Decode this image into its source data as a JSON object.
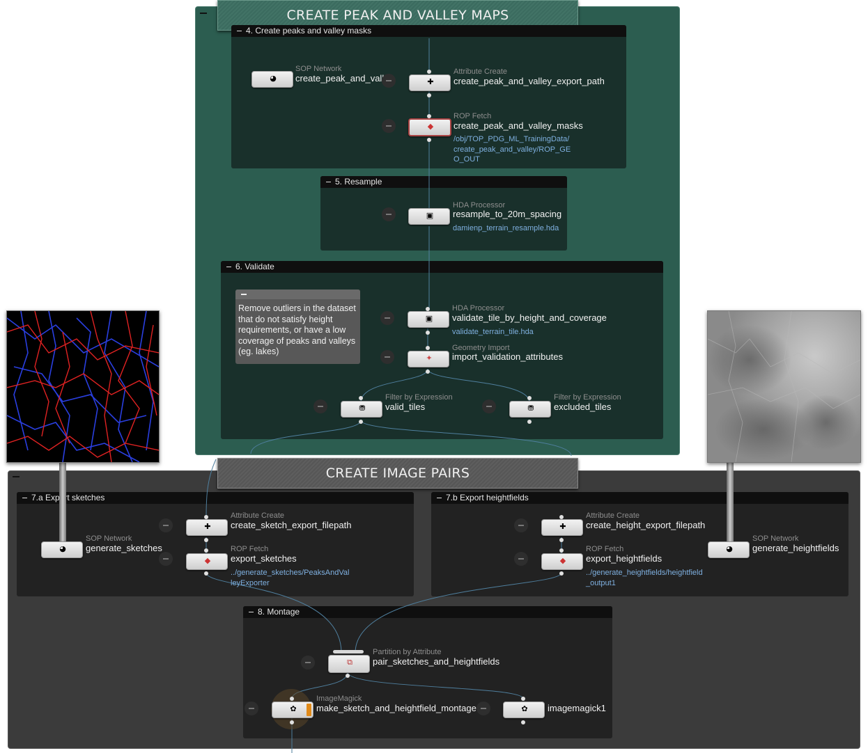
{
  "networks": {
    "peak_valley": {
      "title": "CREATE PEAK AND VALLEY MAPS",
      "color": "#2c5d50"
    },
    "image_pairs": {
      "title": "CREATE IMAGE PAIRS",
      "color": "#3b3b3b"
    }
  },
  "subnets": {
    "masks": {
      "title": "4. Create peaks and valley masks"
    },
    "resample": {
      "title": "5. Resample"
    },
    "validate": {
      "title": "6. Validate"
    },
    "export_sketches": {
      "title": "7.a Export sketches"
    },
    "export_heightfields": {
      "title": "7.b Export heightfields"
    },
    "montage": {
      "title": "8. Montage"
    }
  },
  "sticky_note": {
    "text": "Remove outliers in the dataset that do not satisfy height requirements, or have a low coverage of peaks and valleys (eg. lakes)"
  },
  "nodes": {
    "sop_cpv": {
      "type": "SOP Network",
      "name": "create_peak_and_valley",
      "icon": "sop-network-icon"
    },
    "attr_cpv": {
      "type": "Attribute Create",
      "name": "create_peak_and_valley_export_path",
      "icon": "attribute-create-icon"
    },
    "rop_cpv": {
      "type": "ROP Fetch",
      "name": "create_peak_and_valley_masks",
      "parm": "/obj/TOP_PDG_ML_TrainingData/create_peak_and_valley/ROP_GEO_OUT",
      "icon": "rop-fetch-icon"
    },
    "hda_resample": {
      "type": "HDA Processor",
      "name": "resample_to_20m_spacing",
      "parm": "damienp_terrain_resample.hda",
      "icon": "hda-processor-icon"
    },
    "hda_validate": {
      "type": "HDA Processor",
      "name": "validate_tile_by_height_and_coverage",
      "parm": "validate_terrain_tile.hda",
      "icon": "hda-processor-icon"
    },
    "geo_import": {
      "type": "Geometry Import",
      "name": "import_validation_attributes",
      "icon": "geometry-import-icon"
    },
    "filter_valid": {
      "type": "Filter by Expression",
      "name": "valid_tiles",
      "icon": "filter-icon"
    },
    "filter_excluded": {
      "type": "Filter by Expression",
      "name": "excluded_tiles",
      "icon": "filter-icon"
    },
    "attr_sketch": {
      "type": "Attribute Create",
      "name": "create_sketch_export_filepath",
      "icon": "attribute-create-icon"
    },
    "rop_sketch": {
      "type": "ROP Fetch",
      "name": "export_sketches",
      "parm": "../generate_sketches/PeaksAndValleyExporter",
      "icon": "rop-fetch-icon"
    },
    "sop_sketch": {
      "type": "SOP Network",
      "name": "generate_sketches",
      "icon": "sop-network-icon"
    },
    "attr_height": {
      "type": "Attribute Create",
      "name": "create_height_export_filepath",
      "icon": "attribute-create-icon"
    },
    "rop_height": {
      "type": "ROP Fetch",
      "name": "export_heightfields",
      "parm": "../generate_heightfields/heightfield_output1",
      "icon": "rop-fetch-icon"
    },
    "sop_height": {
      "type": "SOP Network",
      "name": "generate_heightfields",
      "icon": "sop-network-icon"
    },
    "partition": {
      "type": "Partition by Attribute",
      "name": "pair_sketches_and_heightfields",
      "icon": "partition-icon"
    },
    "imagemagick_montage": {
      "type": "ImageMagick",
      "name": "make_sketch_and_heightfield_montage",
      "icon": "imagemagick-icon"
    },
    "imagemagick1": {
      "type": "",
      "name": "imagemagick1",
      "icon": "imagemagick-icon"
    }
  },
  "previews": {
    "sketch": {
      "icon": "sketch-preview-image",
      "colors": [
        "#000000",
        "#e02020",
        "#2030d0"
      ]
    },
    "heightfield": {
      "icon": "heightfield-preview-image",
      "colors": [
        "#5a5a5a",
        "#c8c8c8"
      ]
    }
  }
}
